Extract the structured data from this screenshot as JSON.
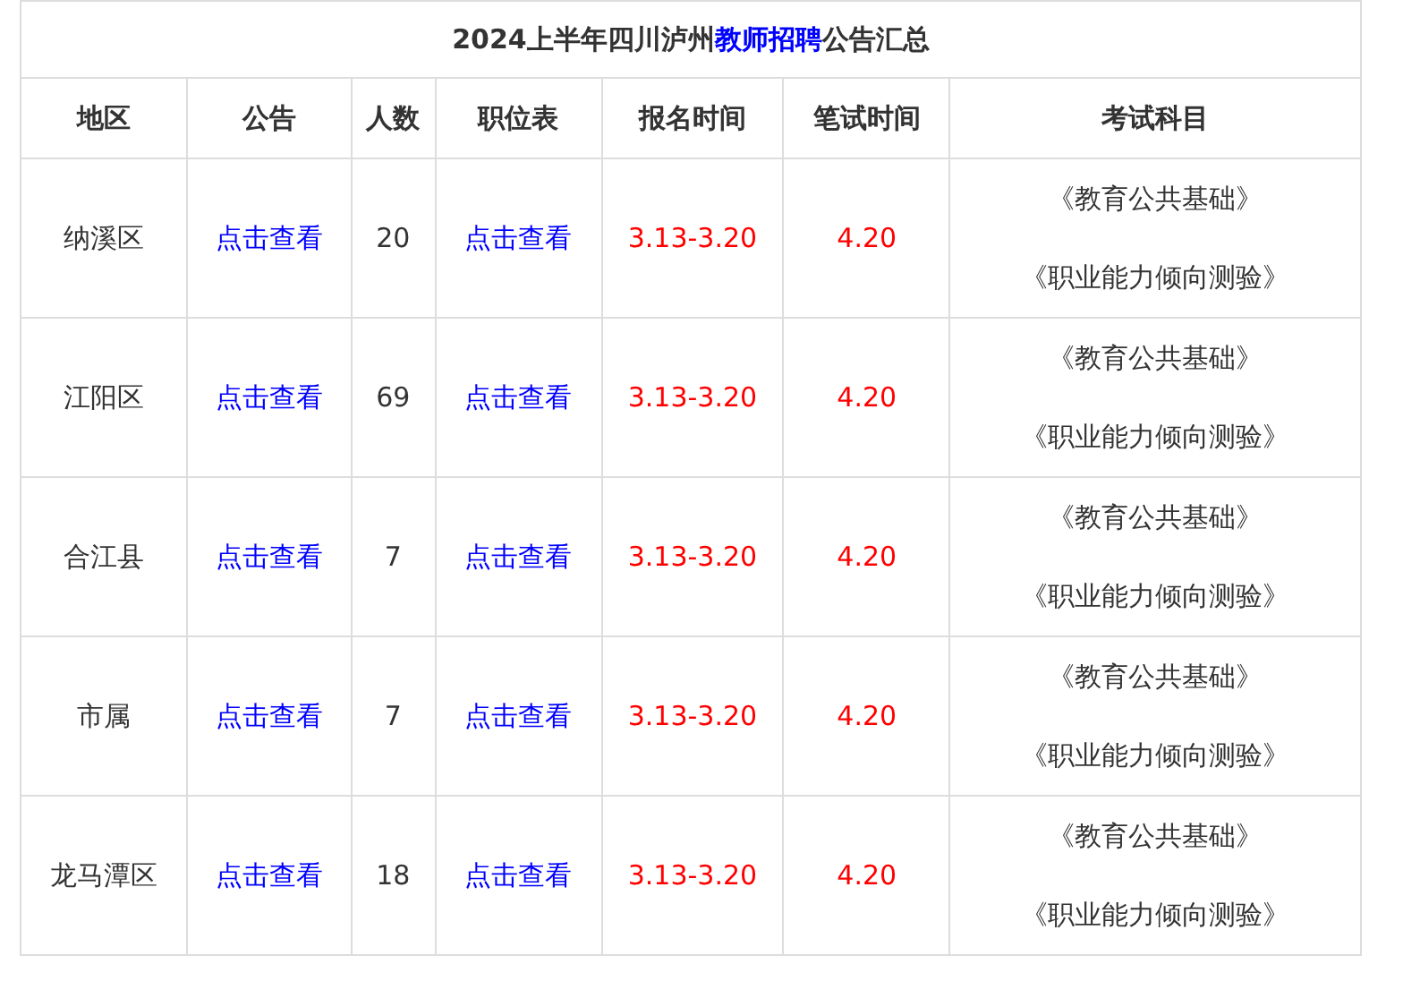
{
  "title": [
    {
      "text": "2024上半年四川泸州",
      "kind": "plain"
    },
    {
      "text": "教师招聘",
      "kind": "link"
    },
    {
      "text": "公告汇总",
      "kind": "plain"
    }
  ],
  "columns": [
    "地区",
    "公告",
    "人数",
    "职位表",
    "报名时间",
    "笔试时间",
    "考试科目"
  ],
  "rows": [
    {
      "region": "纳溪区",
      "notice": "点击查看",
      "count": "20",
      "positions": "点击查看",
      "signup": "3.13-3.20",
      "exam": "4.20",
      "subjects": [
        "《教育公共基础》",
        "《职业能力倾向测验》"
      ]
    },
    {
      "region": "江阳区",
      "notice": "点击查看",
      "count": "69",
      "positions": "点击查看",
      "signup": "3.13-3.20",
      "exam": "4.20",
      "subjects": [
        "《教育公共基础》",
        "《职业能力倾向测验》"
      ]
    },
    {
      "region": "合江县",
      "notice": "点击查看",
      "count": "7",
      "positions": "点击查看",
      "signup": "3.13-3.20",
      "exam": "4.20",
      "subjects": [
        "《教育公共基础》",
        "《职业能力倾向测验》"
      ]
    },
    {
      "region": "市属",
      "notice": "点击查看",
      "count": "7",
      "positions": "点击查看",
      "signup": "3.13-3.20",
      "exam": "4.20",
      "subjects": [
        "《教育公共基础》",
        "《职业能力倾向测验》"
      ]
    },
    {
      "region": "龙马潭区",
      "notice": "点击查看",
      "count": "18",
      "positions": "点击查看",
      "signup": "3.13-3.20",
      "exam": "4.20",
      "subjects": [
        "《教育公共基础》",
        "《职业能力倾向测验》"
      ]
    }
  ]
}
